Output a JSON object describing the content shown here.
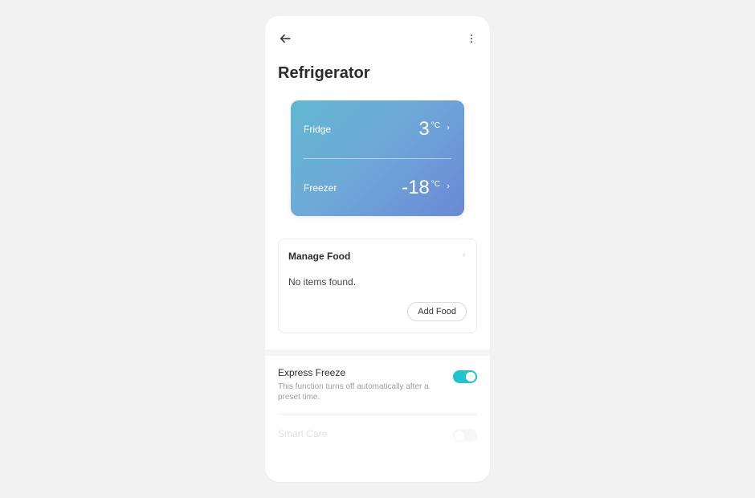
{
  "header": {
    "title": "Refrigerator"
  },
  "temperature_card": {
    "fridge": {
      "label": "Fridge",
      "value": "3",
      "unit": "°C"
    },
    "freezer": {
      "label": "Freezer",
      "value": "-18",
      "unit": "°C"
    }
  },
  "manage_food": {
    "title": "Manage Food",
    "empty_text": "No items found.",
    "add_button_label": "Add Food"
  },
  "settings": {
    "express_freeze": {
      "title": "Express Freeze",
      "subtitle": "This function turns off automatically after a preset time.",
      "enabled": true
    },
    "smart_care": {
      "title": "Smart Care"
    }
  },
  "colors": {
    "accent": "#20c4cc"
  }
}
